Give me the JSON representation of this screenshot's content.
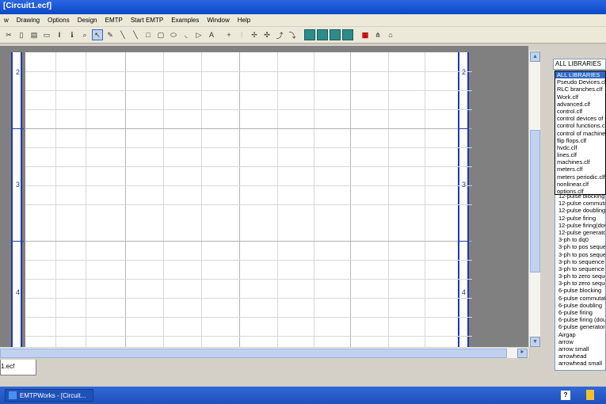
{
  "window": {
    "title": "[Circuit1.ecf]"
  },
  "menu": [
    "w",
    "Drawing",
    "Options",
    "Design",
    "EMTP",
    "Start EMTP",
    "Examples",
    "Window",
    "Help"
  ],
  "toolbar": {
    "icons": [
      "cut-icon",
      "copy-icon",
      "paste-icon",
      "print-icon",
      "bold-icon",
      "info-icon",
      "zoom-icon",
      "pointer-icon",
      "pencil-icon",
      "pen-icon",
      "line-icon",
      "rectangle-icon",
      "rounded-rect-icon",
      "ellipse-icon",
      "arc-icon",
      "polygon-icon",
      "text-icon",
      "cross-icon",
      "bus-icon",
      "node-icon",
      "wire-icon",
      "connect-icon",
      "split-icon",
      "view1-icon",
      "view2-icon",
      "view3-icon",
      "view4-icon",
      "library-icon",
      "hierarchy-icon",
      "home-icon"
    ],
    "text_glyph": "A"
  },
  "drawing": {
    "row_numbers": [
      "2",
      "3",
      "4"
    ]
  },
  "tabs": {
    "active": "1.ecf"
  },
  "library": {
    "selected": "ALL LIBRARIES",
    "dropdown": [
      "ALL LIBRARIES",
      "Pseudo Devices.clf",
      "RLC branches.clf",
      "Work.clf",
      "advanced.clf",
      "control.clf",
      "control devices of",
      "control functions.cl",
      "control of machine",
      "flip flops.clf",
      "hvdc.clf",
      "lines.clf",
      "machines.clf",
      "meters.clf",
      "meters periodic.clf",
      "nonlinear.clf",
      "options.clf"
    ],
    "items": [
      "12-pulse blocking",
      "12-pulse commuta",
      "12-pulse doubling",
      "12-pulse firing",
      "12-pulse firing(dou",
      "12-pulse generato",
      "3-ph to dq0",
      "3-ph to pos seque",
      "3-ph to pos seque",
      "3-ph to sequence",
      "3-ph to sequence",
      "3-ph to zero seque",
      "3-ph to zero seque",
      "6-pulse blocking",
      "6-pulse commutati",
      "6-pulse doubling",
      "6-pulse firing",
      "6-pulse firing (doub",
      "6-pulse generator",
      "Airgap",
      "arrow",
      "arrow small",
      "arrowhead",
      "arrowhead small"
    ]
  },
  "taskbar": {
    "button_label": "EMTPWorks - [Circuit...",
    "help_glyph": "?"
  }
}
